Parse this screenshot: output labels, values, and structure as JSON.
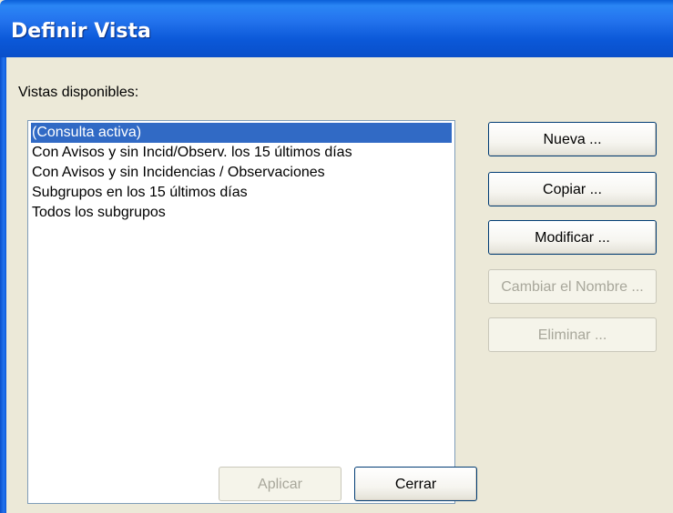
{
  "window": {
    "title": "Definir Vista"
  },
  "list": {
    "label": "Vistas disponibles:",
    "items": [
      "(Consulta activa)",
      "Con Avisos y sin Incid/Observ. los 15 últimos días",
      "Con Avisos y sin Incidencias / Observaciones",
      "Subgrupos en los 15 últimos días",
      "Todos los subgrupos"
    ],
    "selected_index": 0
  },
  "buttons": {
    "nueva": "Nueva ...",
    "copiar": "Copiar ...",
    "modificar": "Modificar ...",
    "cambiar_nombre": "Cambiar el Nombre ...",
    "eliminar": "Eliminar ...",
    "aplicar": "Aplicar",
    "cerrar": "Cerrar"
  },
  "colors": {
    "titlebar": "#0a58d8",
    "selection": "#316ac5",
    "face": "#ece9d8"
  }
}
